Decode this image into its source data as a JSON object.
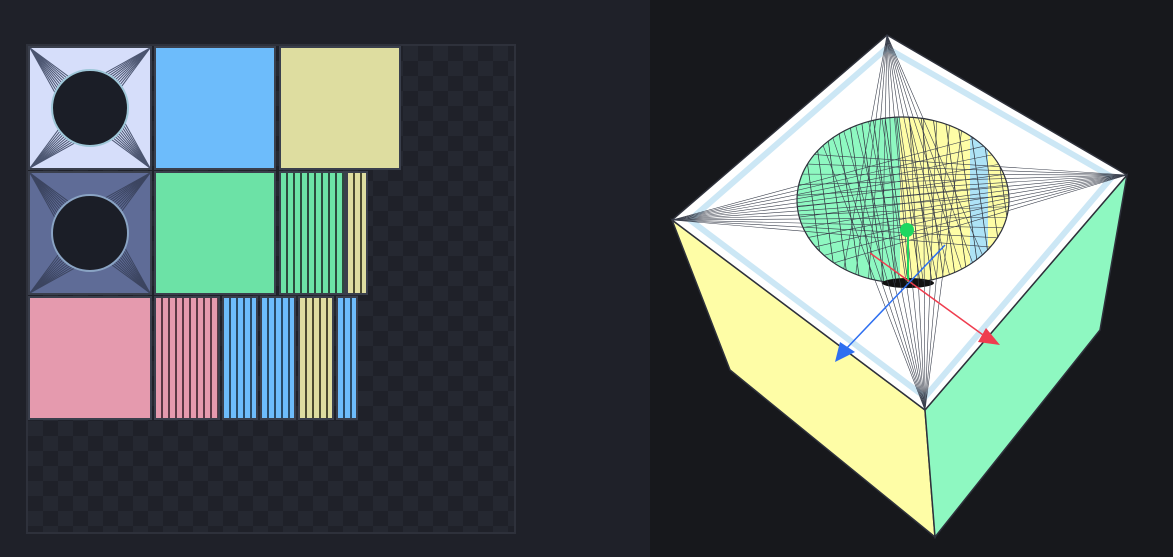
{
  "colors": {
    "bg_left": "#1f2129",
    "bg_right": "#17181c",
    "blue": "#6dbcfb",
    "yellow": "#dedda0",
    "green": "#6ce2a6",
    "pink": "#e59aae",
    "light_lavender": "#d6defa",
    "dark_slate": "#5f6c97",
    "cube_top": "#ffffff",
    "cube_left": "#fefda6",
    "cube_right": "#8ef8c1",
    "gizmo_x": "#ef3d4f",
    "gizmo_y": "#1ed760",
    "gizmo_z": "#2e6ff0"
  },
  "icons": {
    "gizmo_x_arrow": "x-axis-arrow-icon",
    "gizmo_y_arrow": "y-axis-arrow-icon",
    "gizmo_z_arrow": "z-axis-arrow-icon"
  }
}
